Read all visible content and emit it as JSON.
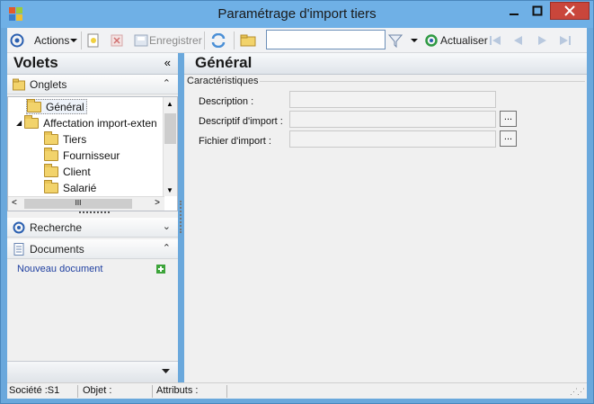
{
  "window": {
    "title": "Paramétrage d'import tiers"
  },
  "toolbar": {
    "actions_label": "Actions",
    "enregistrer_label": "Enregistrer",
    "search_value": "",
    "actualiser_label": "Actualiser"
  },
  "left": {
    "volets_title": "Volets",
    "onglets_label": "Onglets",
    "tree": [
      "Général",
      "Affectation import-exten",
      "Tiers",
      "Fournisseur",
      "Client",
      "Salarié"
    ],
    "recherche_label": "Recherche",
    "documents_label": "Documents",
    "nouveau_document": "Nouveau document"
  },
  "right": {
    "title": "Général",
    "group_title": "Caractéristiques",
    "fields": [
      {
        "label": "Description :",
        "value": ""
      },
      {
        "label": "Descriptif d'import :",
        "value": ""
      },
      {
        "label": "Fichier d'import :",
        "value": ""
      }
    ],
    "browse_label": "..."
  },
  "status": {
    "societe": "Société :S1",
    "objet": "Objet :",
    "attributs": "Attributs :"
  },
  "colors": {
    "title_bar": "#6fb0e6",
    "close_button": "#c9463b",
    "link": "#1f3fa0"
  }
}
